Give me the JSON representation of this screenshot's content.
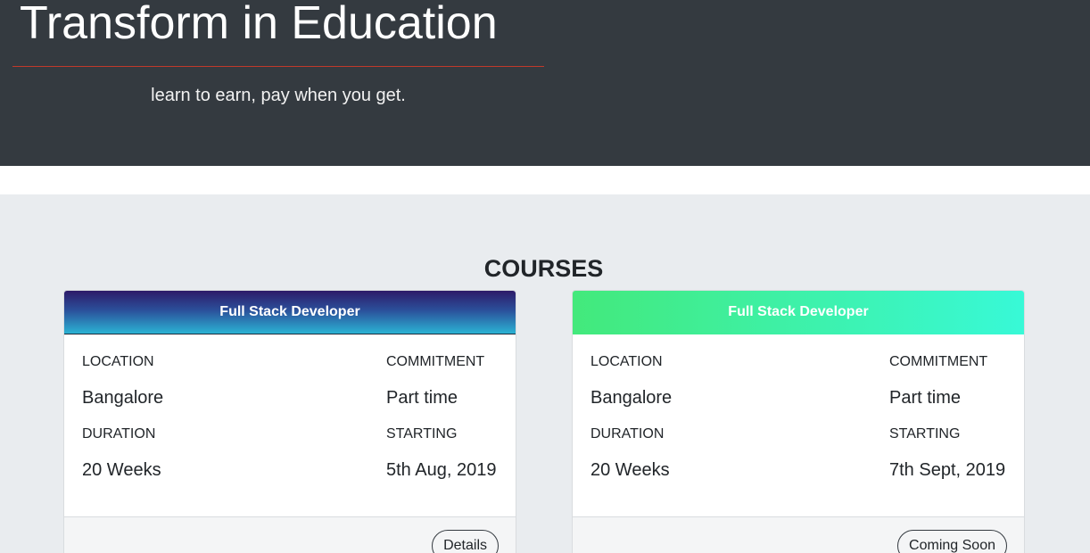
{
  "hero": {
    "title": "Transform in Education",
    "subtitle": "learn to earn, pay when you get."
  },
  "courses": {
    "heading": "COURSES",
    "items": [
      {
        "title": "Full Stack Developer",
        "location_label": "LOCATION",
        "location": "Bangalore",
        "commitment_label": "COMMITMENT",
        "commitment": "Part time",
        "duration_label": "DURATION",
        "duration": "20 Weeks",
        "starting_label": "STARTING",
        "starting": "5th Aug, 2019",
        "button_label": "Details"
      },
      {
        "title": "Full Stack Developer",
        "location_label": "LOCATION",
        "location": "Bangalore",
        "commitment_label": "COMMITMENT",
        "commitment": "Part time",
        "duration_label": "DURATION",
        "duration": "20 Weeks",
        "starting_label": "STARTING",
        "starting": "7th Sept, 2019",
        "button_label": "Coming Soon"
      }
    ]
  },
  "colors": {
    "hero_background": "#343a40",
    "hero_rule": "#c0392b",
    "section_background": "#e9ecef",
    "card1_header_gradient": [
      "#2d1b69",
      "#2bb3d4"
    ],
    "card2_header_gradient": [
      "#43e97b",
      "#38f9d7"
    ]
  }
}
